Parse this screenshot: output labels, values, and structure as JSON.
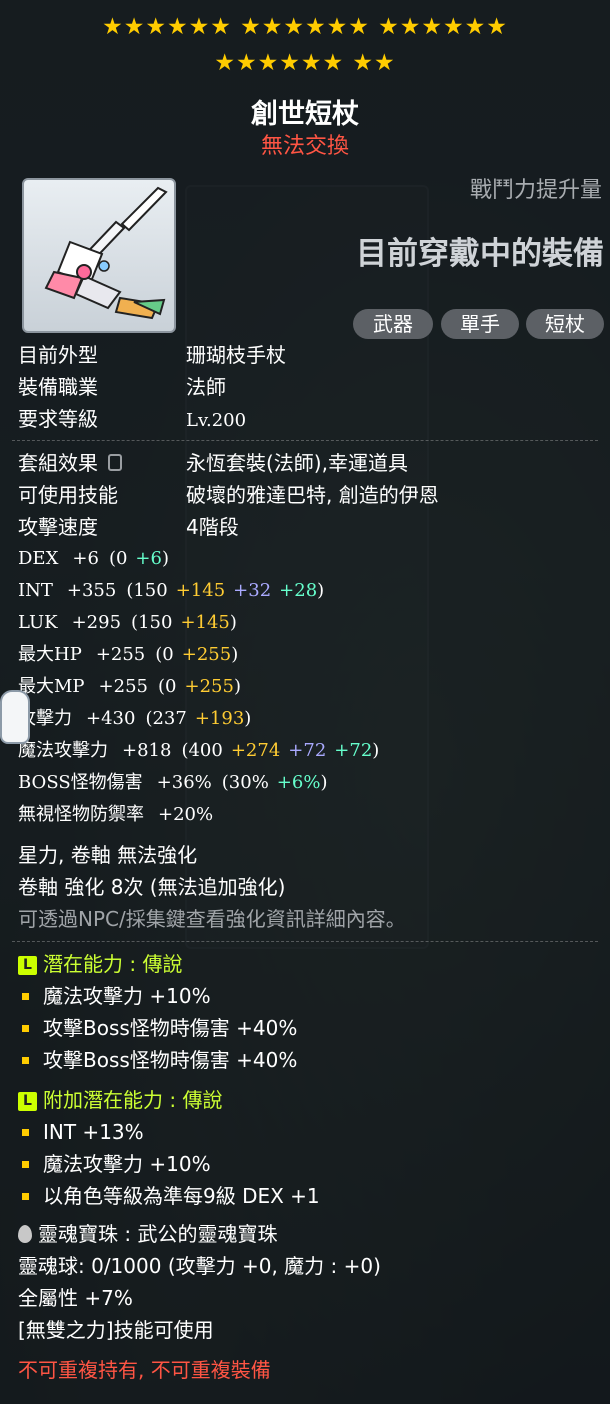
{
  "stars": {
    "row1": "★★★★★★ ★★★★★★ ★★★★★★",
    "row2": "★★★★★★ ★★"
  },
  "item": {
    "name": "創世短杖",
    "trade": "無法交換"
  },
  "combat": {
    "label": "戰鬥力提升量",
    "current": "目前穿戴中的裝備"
  },
  "tags": [
    "武器",
    "單手",
    "短杖"
  ],
  "basic": [
    {
      "label": "目前外型",
      "value": "珊瑚枝手杖"
    },
    {
      "label": "裝備職業",
      "value": "法師"
    },
    {
      "label": "要求等級",
      "value": "Lv.200"
    }
  ],
  "info": [
    {
      "label": "套組效果",
      "value": "永恆套裝(法師),幸運道具"
    },
    {
      "label": "可使用技能",
      "value": "破壞的雅達巴特, 創造的伊恩"
    },
    {
      "label": "攻擊速度",
      "value": "4階段"
    }
  ],
  "stats": [
    {
      "name": "DEX",
      "total": "+6",
      "base": "(0",
      "parts": [
        {
          "v": "+6",
          "c": "grn"
        }
      ],
      "close": ")"
    },
    {
      "name": "INT",
      "total": "+355",
      "base": "(150",
      "parts": [
        {
          "v": "+145",
          "c": "yel"
        },
        {
          "v": "+32",
          "c": "pur"
        },
        {
          "v": "+28",
          "c": "grn"
        }
      ],
      "close": ")"
    },
    {
      "name": "LUK",
      "total": "+295",
      "base": "(150",
      "parts": [
        {
          "v": "+145",
          "c": "yel"
        }
      ],
      "close": ")"
    },
    {
      "name": "最大HP",
      "total": "+255",
      "base": "(0",
      "parts": [
        {
          "v": "+255",
          "c": "yel"
        }
      ],
      "close": ")"
    },
    {
      "name": "最大MP",
      "total": "+255",
      "base": "(0",
      "parts": [
        {
          "v": "+255",
          "c": "yel"
        }
      ],
      "close": ")"
    },
    {
      "name": "攻擊力",
      "total": "+430",
      "base": "(237",
      "parts": [
        {
          "v": "+193",
          "c": "yel"
        }
      ],
      "close": ")"
    },
    {
      "name": "魔法攻擊力",
      "total": "+818",
      "base": "(400",
      "parts": [
        {
          "v": "+274",
          "c": "yel"
        },
        {
          "v": "+72",
          "c": "pur"
        },
        {
          "v": "+72",
          "c": "grn"
        }
      ],
      "close": ")"
    },
    {
      "name": "BOSS怪物傷害",
      "total": "+36%",
      "base": "(30%",
      "parts": [
        {
          "v": "+6%",
          "c": "grn"
        }
      ],
      "close": ")"
    },
    {
      "name": "無視怪物防禦率",
      "total": "+20%",
      "base": "",
      "parts": [],
      "close": ""
    }
  ],
  "enhance": {
    "star": "星力, 卷軸 無法強化",
    "scroll": "卷軸 強化 8次 (無法追加強化)",
    "hint": "可透過NPC/採集鍵查看強化資訊詳細內容。"
  },
  "potential": {
    "badge": "L",
    "title": "潛在能力 : 傳說",
    "lines": [
      "魔法攻擊力 +10%",
      "攻擊Boss怪物時傷害 +40%",
      "攻擊Boss怪物時傷害 +40%"
    ]
  },
  "bonus_potential": {
    "badge": "L",
    "title": "附加潛在能力 : 傳說",
    "lines": [
      "INT +13%",
      "魔法攻擊力 +10%",
      "以角色等級為準每9級 DEX +1"
    ]
  },
  "soul": {
    "name": "靈魂寶珠 : 武公的靈魂寶珠",
    "orb": "靈魂球: 0/1000 (攻擊力 +0, 魔力 : +0)",
    "allstat": "全屬性 +7%",
    "skill": "[無雙之力]技能可使用"
  },
  "warning": "不可重複持有, 不可重複裝備",
  "colors": {
    "legendary": "#ccff33",
    "star": "#ffcc00",
    "untradable": "#ff5544"
  }
}
